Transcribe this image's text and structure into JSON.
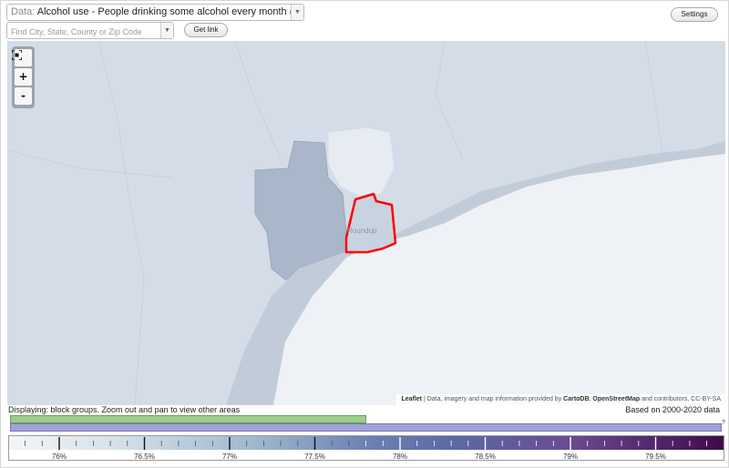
{
  "controls": {
    "data_prefix": "Data:",
    "data_value": "Alcohol use - People drinking some alcohol every month (%)",
    "search_placeholder": "Find City, State, County or Zip Code",
    "get_link_label": "Get link",
    "settings_label": "Settings"
  },
  "map": {
    "place_label": "Roundup",
    "attribution": {
      "leaflet": "Leaflet",
      "text1": " | Data, imagery and map information provided by ",
      "cartodb": "CartoDB",
      "comma": ", ",
      "osm": "OpenStreetMap",
      "text2": " and contributors, CC-BY-SA"
    },
    "zoom": {
      "fit_icon": "fit-bounds-icon",
      "zoom_in": "+",
      "zoom_out": "-"
    },
    "colors": {
      "background": "#d3dce6",
      "highlight": "#ff0000",
      "light_area": "#eef2f6",
      "dark_area": "#a9b5c9"
    }
  },
  "bottom": {
    "displaying": "Displaying: block groups. Zoom out and pan to view other areas",
    "based_on": "Based on 2000-2020 data",
    "help_mark": "?",
    "legend_ticks": [
      "76%",
      "76.5%",
      "77%",
      "77.5%",
      "78%",
      "78.5%",
      "79%",
      "79.5%"
    ],
    "colors": {
      "bar_green": "#9bcf8c",
      "bar_purple": "#a3a2d7",
      "legend_start": "#f1f4f6",
      "legend_mid": "#5a6fa5",
      "legend_end": "#4a0e52"
    }
  }
}
